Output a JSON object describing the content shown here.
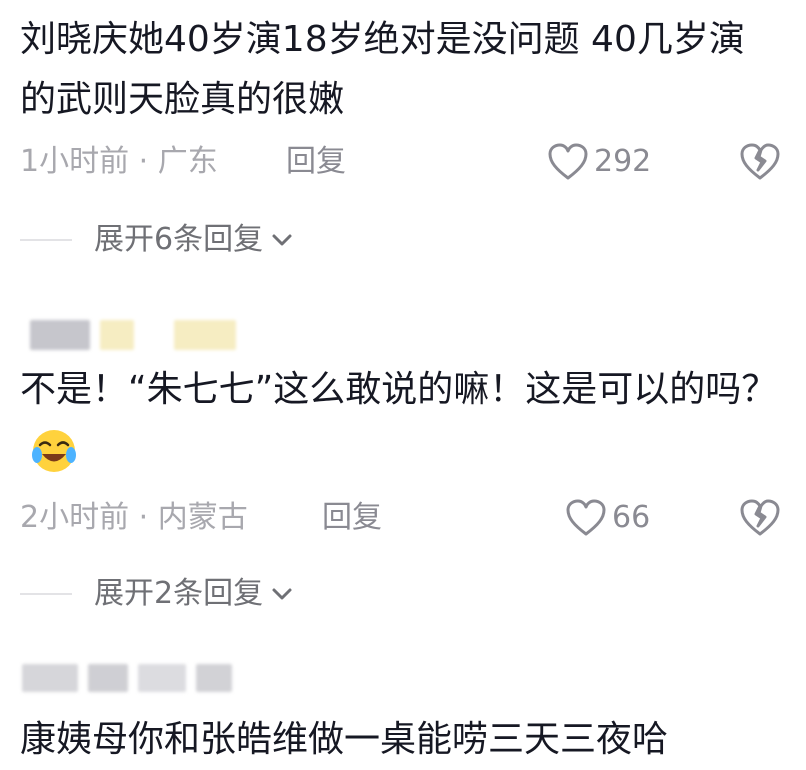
{
  "comments": [
    {
      "text": "刘晓庆她40岁演18岁绝对是没问题 40几岁演的武则天脸真的很嫩",
      "time_location": "1小时前 · 广东",
      "reply_label": "回复",
      "like_count": "292",
      "expand_label": "展开6条回复"
    },
    {
      "username_blurred": true,
      "text": "不是！“朱七七”这么敢说的嘛！这是可以的吗？",
      "emoji": "crying-laughing-emoji",
      "time_location": "2小时前 · 内蒙古",
      "reply_label": "回复",
      "like_count": "66",
      "expand_label": "展开2条回复"
    },
    {
      "username_blurred": true,
      "text": "康姨母你和张皓维做一桌能唠三天三夜哈"
    }
  ],
  "colors": {
    "text": "#161823",
    "meta": "#a8a8ae",
    "secondary": "#8a8a92",
    "expand": "#6f7075",
    "blur_gray": "#c6c6cc",
    "blur_yellow": "#f6edc2"
  },
  "icons": {
    "like": "heart-outline-icon",
    "dislike": "broken-heart-icon",
    "expand": "chevron-down-icon"
  }
}
